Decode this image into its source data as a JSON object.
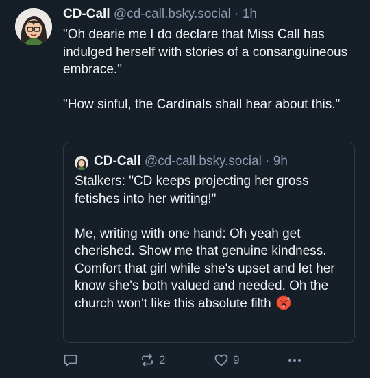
{
  "post": {
    "author_name": "CD-Call",
    "author_handle": "@cd-call.bsky.social",
    "separator": "·",
    "time": "1h",
    "text": "\"Oh dearie me I do declare that Miss Call has indulged herself with stories of a consanguineous embrace.\"\n\n\"How sinful, the Cardinals shall hear about this.\""
  },
  "quote": {
    "author_name": "CD-Call",
    "author_handle": "@cd-call.bsky.social",
    "separator": "·",
    "time": "9h",
    "text": "Stalkers: \"CD keeps projecting her gross fetishes into her writing!\"\n\nMe, writing with one hand: Oh yeah get cherished. Show me that genuine kindness. Comfort that girl while she's upset and let her know she's both valued and needed. Oh the church won't like this absolute filth",
    "emoji_icon": "hot-face-emoji"
  },
  "actions": {
    "repost_count": "2",
    "like_count": "9"
  },
  "colors": {
    "background": "#161e27",
    "text": "#f1f3f5",
    "muted": "#8c9bb0",
    "border": "#2e3a48"
  }
}
